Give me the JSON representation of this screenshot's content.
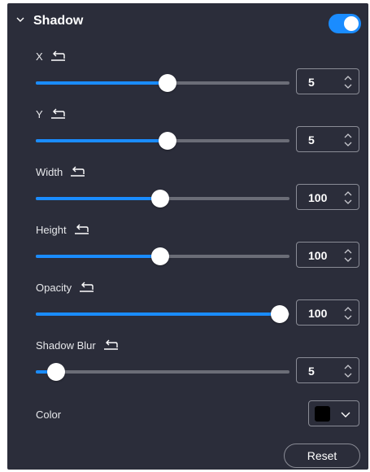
{
  "panel": {
    "title": "Shadow",
    "enabled": true,
    "accent_color": "#1a8cff",
    "background_color": "#2b2d3a",
    "collapse_icon": "chevron-down-icon",
    "reset_icon": "undo-icon"
  },
  "controls": [
    {
      "label": "X",
      "value": "5",
      "slider_fraction": 0.52
    },
    {
      "label": "Y",
      "value": "5",
      "slider_fraction": 0.52
    },
    {
      "label": "Width",
      "value": "100",
      "slider_fraction": 0.49
    },
    {
      "label": "Height",
      "value": "100",
      "slider_fraction": 0.49
    },
    {
      "label": "Opacity",
      "value": "100",
      "slider_fraction": 0.96
    },
    {
      "label": "Shadow Blur",
      "value": "5",
      "slider_fraction": 0.08
    }
  ],
  "color": {
    "label": "Color",
    "value_color": "#000000"
  },
  "actions": {
    "reset_label": "Reset"
  }
}
